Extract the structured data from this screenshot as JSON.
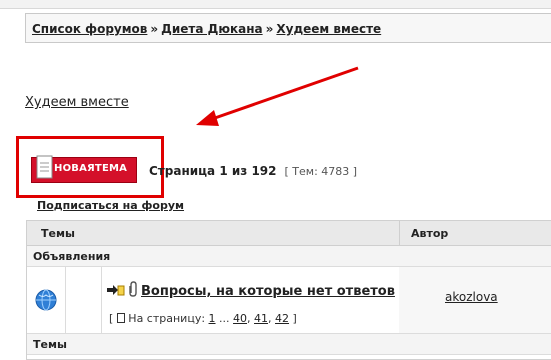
{
  "breadcrumb": {
    "items": [
      "Список форумов",
      "Диета Дюкана",
      "Худеем вместе"
    ],
    "separator": "»"
  },
  "forum": {
    "title": "Худеем вместе"
  },
  "actions": {
    "new_topic_label": "НОВАЯТЕМА",
    "subscribe_label": "Подписаться на форум"
  },
  "pagination": {
    "page_text_prefix": "Страница ",
    "current": "1",
    "of_text": " из ",
    "total": "192",
    "topics_text": "[ Тем: 4783 ]"
  },
  "table": {
    "headers": {
      "topics": "Темы",
      "author": "Автор"
    },
    "sections": {
      "announcements": "Объявления",
      "topics": "Темы"
    },
    "rows": [
      {
        "title": "Вопросы, на которые нет ответов",
        "pages_prefix": "На страницу:",
        "pages": [
          "1",
          "...",
          "40",
          "41",
          "42"
        ],
        "author": "akozlova"
      }
    ]
  },
  "colors": {
    "highlight": "#e00000",
    "button_bg": "#d4102a"
  },
  "icons": [
    "arrow-annotation-icon",
    "document-icon",
    "globe-icon",
    "sticky-arrow-icon",
    "paperclip-icon",
    "pages-doc-icon"
  ]
}
